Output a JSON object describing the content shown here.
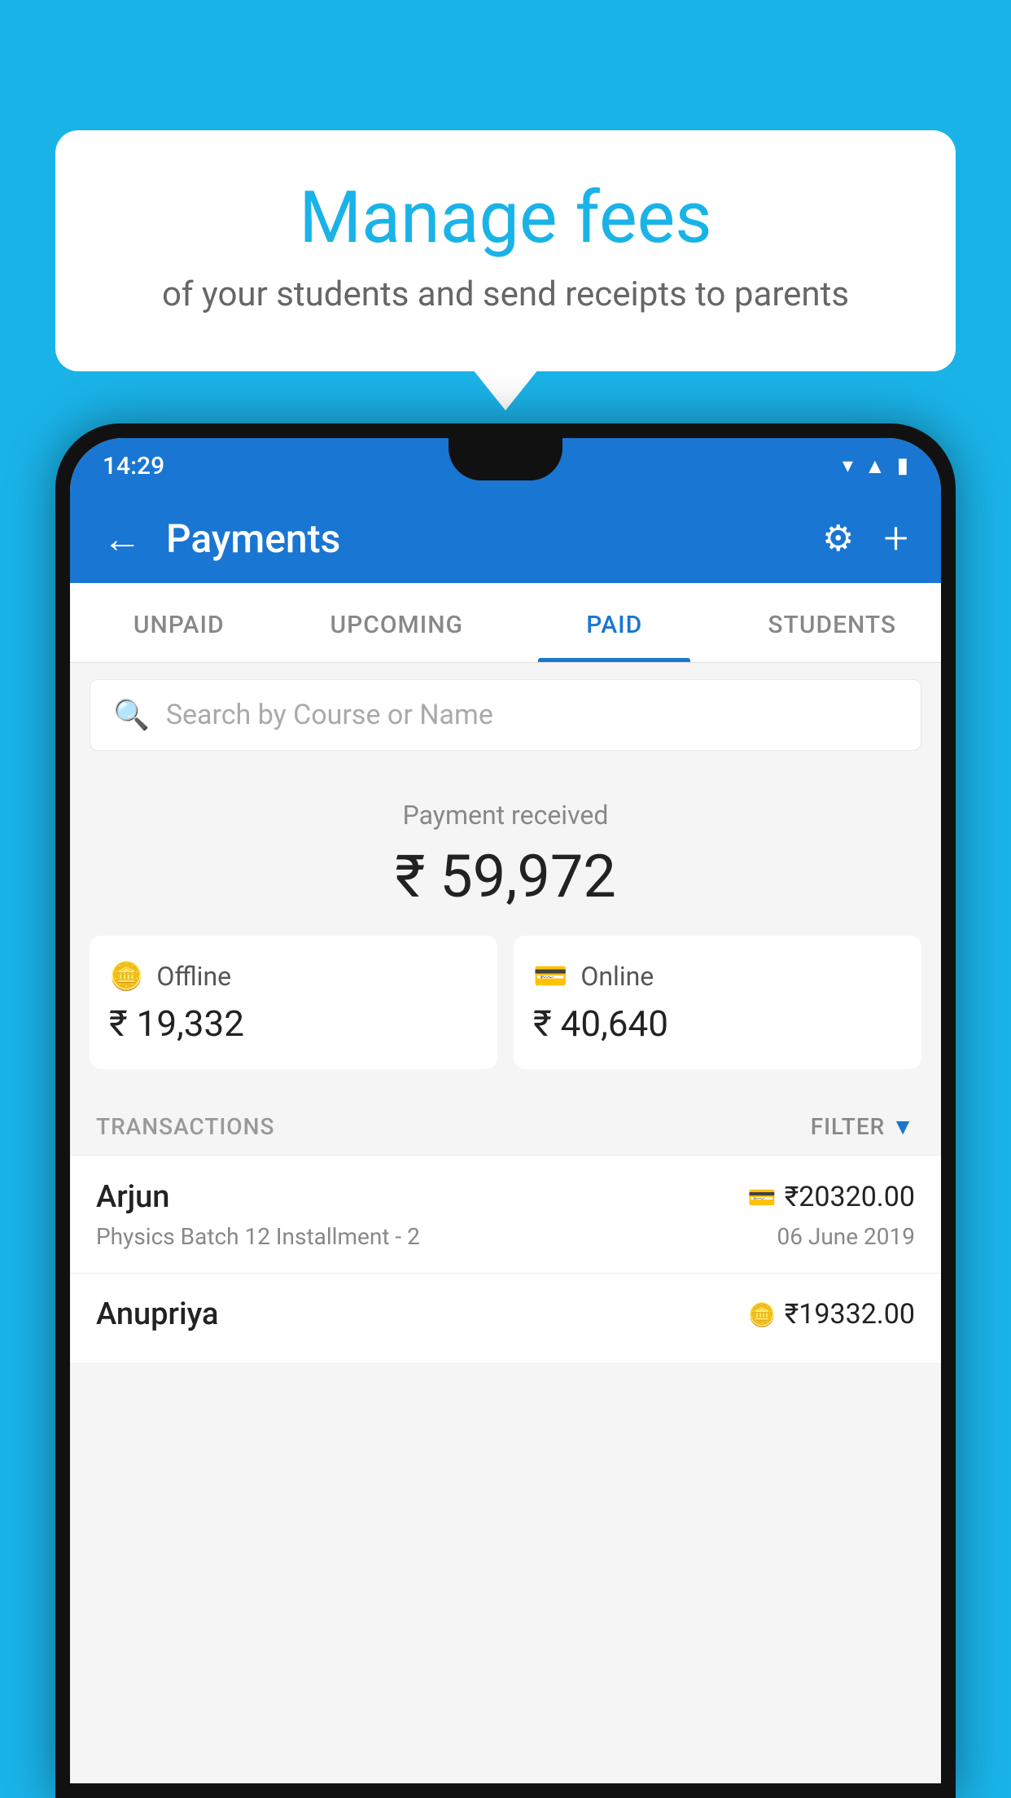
{
  "background_color": "#1ab3e8",
  "bubble": {
    "title": "Manage fees",
    "subtitle": "of your students and send receipts to parents"
  },
  "status_bar": {
    "time": "14:29",
    "icons": [
      "wifi",
      "signal",
      "battery"
    ]
  },
  "app_bar": {
    "title": "Payments",
    "back_label": "←",
    "settings_icon": "⚙",
    "add_icon": "+"
  },
  "tabs": [
    {
      "label": "UNPAID",
      "active": false
    },
    {
      "label": "UPCOMING",
      "active": false
    },
    {
      "label": "PAID",
      "active": true
    },
    {
      "label": "STUDENTS",
      "active": false
    }
  ],
  "search": {
    "placeholder": "Search by Course or Name"
  },
  "payment_summary": {
    "label": "Payment received",
    "amount": "₹ 59,972",
    "offline": {
      "type": "Offline",
      "amount": "₹ 19,332"
    },
    "online": {
      "type": "Online",
      "amount": "₹ 40,640"
    }
  },
  "transactions": {
    "header": "TRANSACTIONS",
    "filter": "FILTER",
    "rows": [
      {
        "name": "Arjun",
        "course": "Physics Batch 12 Installment - 2",
        "amount": "₹20320.00",
        "date": "06 June 2019",
        "mode": "card"
      },
      {
        "name": "Anupriya",
        "course": "",
        "amount": "₹19332.00",
        "date": "",
        "mode": "cash"
      }
    ]
  }
}
